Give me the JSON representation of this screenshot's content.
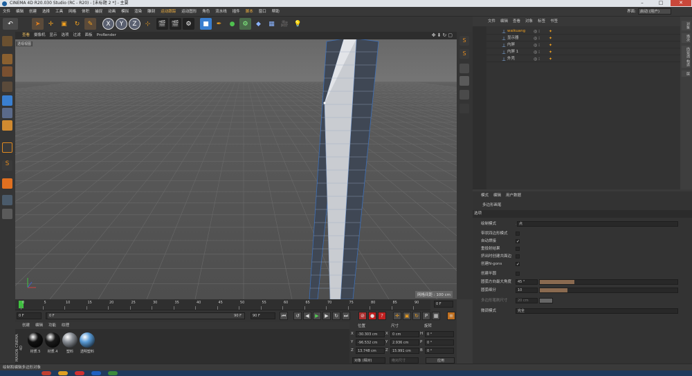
{
  "window": {
    "title": "CINEMA 4D R20.030 Studio (RC - R20) - [未标题 2 *] - 主要"
  },
  "menubar": {
    "items": [
      "文件",
      "编辑",
      "创建",
      "选择",
      "工具",
      "网格",
      "体积",
      "捕捉",
      "动画",
      "模拟",
      "渲染",
      "雕刻",
      "运动跟踪",
      "运动图形",
      "角色",
      "流水线",
      "插件",
      "脚本",
      "窗口",
      "帮助"
    ],
    "highlighted": [
      "运动跟踪",
      "脚本"
    ]
  },
  "layout": {
    "label": "界面:",
    "value": "启动 (用户)"
  },
  "toolbar": {
    "axis": [
      "X",
      "Y",
      "Z"
    ]
  },
  "viewport": {
    "menu": [
      "查看",
      "摄像机",
      "显示",
      "选项",
      "过滤",
      "面板",
      "ProRender"
    ],
    "label": "透视视图",
    "scale": "网格间距 : 100 cm"
  },
  "objects": {
    "menu": [
      "文件",
      "编辑",
      "查看",
      "对象",
      "标签",
      "书签"
    ],
    "rows": [
      {
        "name": "waikuang",
        "active": true
      },
      {
        "name": "显示器",
        "active": false
      },
      {
        "name": "内屏",
        "active": false
      },
      {
        "name": "内屏 1",
        "active": false
      },
      {
        "name": "外壳",
        "active": false
      }
    ]
  },
  "right_tabs": [
    "对象",
    "场次",
    "内容浏览器",
    "构造",
    "层"
  ],
  "attributes": {
    "menu": [
      "模式",
      "编辑",
      "用户数据"
    ],
    "object_name": "多边形画笔",
    "tab": "选项",
    "draw_mode": {
      "label": "绘制模式",
      "value": "点"
    },
    "checks": [
      {
        "label": "带状四边形模式",
        "checked": false
      },
      {
        "label": "自动焊接",
        "checked": true
      },
      {
        "label": "重投射结果",
        "checked": false
      },
      {
        "label": "挤出时创建共面边",
        "checked": false
      },
      {
        "label": "创建N-gons",
        "checked": true
      }
    ],
    "create_semicircle": {
      "label": "创建半圆",
      "checked": false
    },
    "arc_max_angle": {
      "label": "圆弧方向最大角度",
      "value": "45 °",
      "fill": 0.25
    },
    "arc_subdiv": {
      "label": "圆弧细分",
      "value": "10",
      "fill": 0.2
    },
    "poly_size": {
      "label": "多边形笔刷尺寸",
      "value": "20 cm"
    },
    "hud_mode": {
      "label": "微调模式",
      "value": "完全"
    }
  },
  "timeline": {
    "ticks": [
      "0",
      "5",
      "10",
      "15",
      "20",
      "25",
      "30",
      "35",
      "40",
      "45",
      "50",
      "55",
      "60",
      "65",
      "70",
      "75",
      "80",
      "85",
      "90"
    ],
    "current_frame": "0 F",
    "start": "0 F",
    "start2": "0 F",
    "end": "90 F",
    "end2": "90 F"
  },
  "materials": {
    "menu": [
      "创建",
      "编辑",
      "功能",
      "纹理"
    ],
    "items": [
      {
        "label": "材质.5",
        "color": "#111111"
      },
      {
        "label": "材质.4",
        "color": "#1a1a1a"
      },
      {
        "label": "塑料",
        "color": "#8a8f96"
      },
      {
        "label": "透明塑料",
        "color": "#5a9bd6"
      }
    ],
    "brand": "MAXON CINEMA 4D"
  },
  "coords": {
    "headers": [
      "位置",
      "尺寸",
      "旋转"
    ],
    "position": [
      {
        "axis": "X",
        "value": "-30.303 cm"
      },
      {
        "axis": "Y",
        "value": "-96.532 cm"
      },
      {
        "axis": "Z",
        "value": "13.748 cm"
      }
    ],
    "size": [
      {
        "axis": "X",
        "value": "0 cm"
      },
      {
        "axis": "Y",
        "value": "2.936 cm"
      },
      {
        "axis": "Z",
        "value": "15.991 cm"
      }
    ],
    "rotation": [
      {
        "axis": "H",
        "value": "0 °"
      },
      {
        "axis": "P",
        "value": "0 °"
      },
      {
        "axis": "B",
        "value": "0 °"
      }
    ],
    "mode": "对象 (相对)",
    "size_mode": "绝对尺寸",
    "apply": "应用"
  },
  "status": "绘制和编辑多边形对象"
}
